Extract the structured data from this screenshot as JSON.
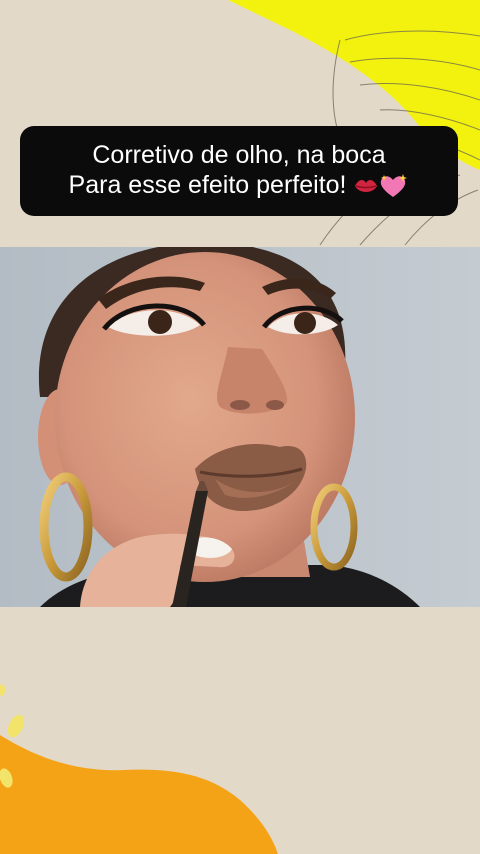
{
  "caption": {
    "line1": "Corretivo de olho, na boca",
    "line2": "Para esse efeito perfeito!",
    "emoji_1": "kiss-mark-emoji",
    "emoji_2": "sparkling-heart-emoji"
  },
  "colors": {
    "background": "#e2d9c8",
    "accent_yellow": "#f2f20e",
    "accent_orange": "#f5a316",
    "caption_bg": "#0b0b0b",
    "caption_text": "#ffffff"
  },
  "video": {
    "subject": "makeup-tutorial-lip-liner"
  }
}
